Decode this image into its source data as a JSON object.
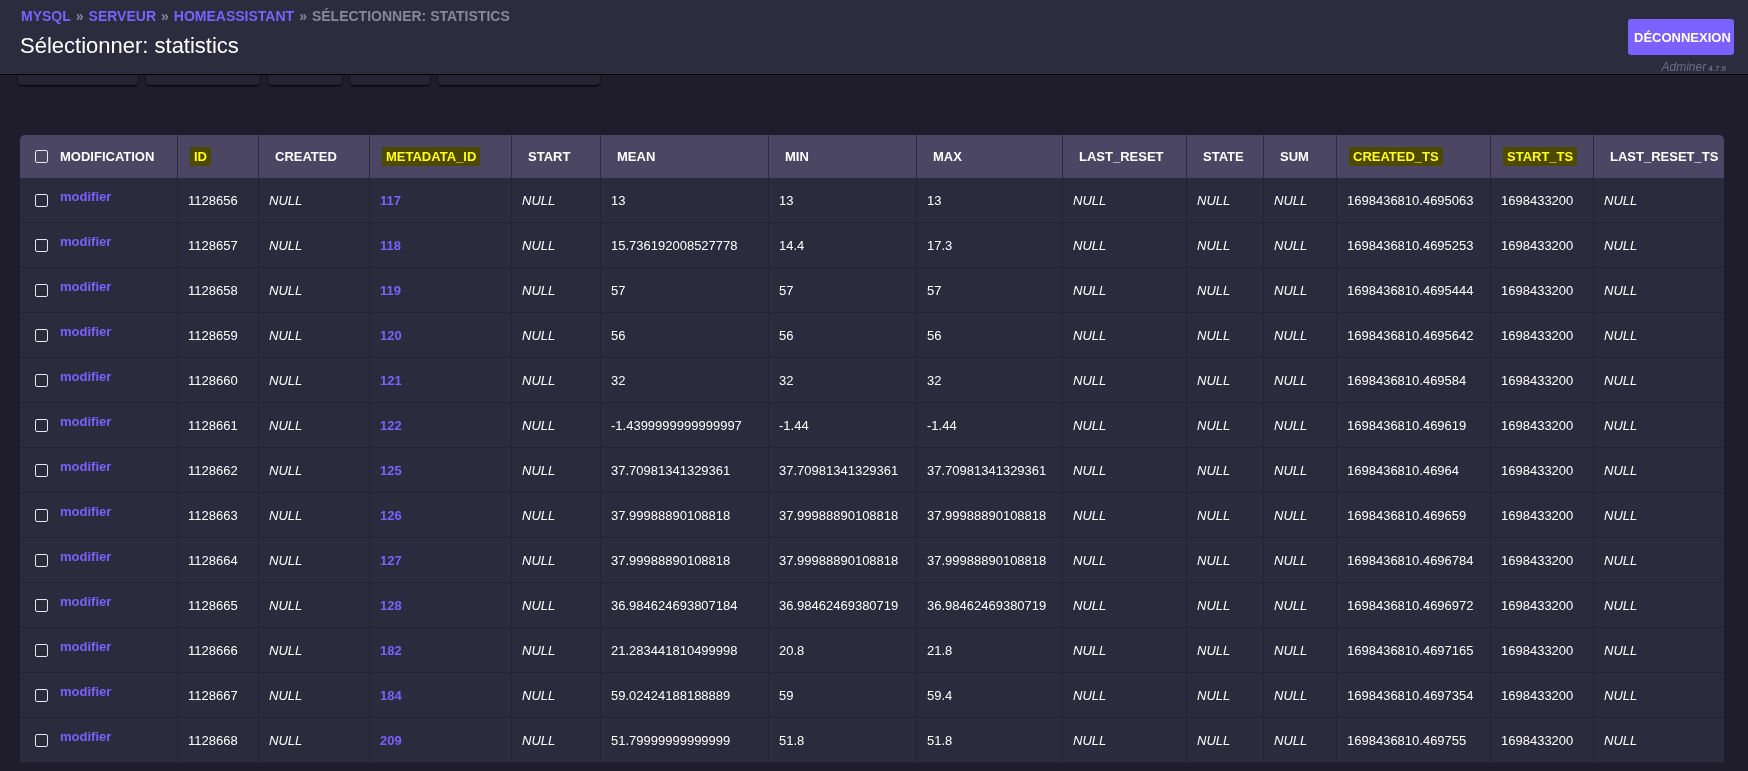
{
  "breadcrumb": [
    {
      "label": "MYSQL",
      "kind": "link"
    },
    {
      "label": "»",
      "kind": "separator"
    },
    {
      "label": "SERVEUR",
      "kind": "link"
    },
    {
      "label": "»",
      "kind": "separator"
    },
    {
      "label": "HOMEASSISTANT",
      "kind": "link"
    },
    {
      "label": "»",
      "kind": "separator"
    },
    {
      "label": "SÉLECTIONNER: STATISTICS",
      "kind": "current"
    }
  ],
  "title": "Sélectionner: statistics",
  "logout_button": "DÉCONNEXION",
  "app_name": "Adminer",
  "app_version": "4.7.9",
  "table": {
    "select_all": {
      "checked": false
    },
    "action_column": "MODIFICATION",
    "columns": [
      {
        "label": "ID",
        "kind": "plain",
        "highlighted": true
      },
      {
        "label": "CREATED",
        "kind": "null",
        "highlighted": false
      },
      {
        "label": "METADATA_ID",
        "kind": "link",
        "highlighted": true
      },
      {
        "label": "START",
        "kind": "null",
        "highlighted": false
      },
      {
        "label": "MEAN",
        "kind": "plain",
        "highlighted": false
      },
      {
        "label": "MIN",
        "kind": "plain",
        "highlighted": false
      },
      {
        "label": "MAX",
        "kind": "plain",
        "highlighted": false
      },
      {
        "label": "LAST_RESET",
        "kind": "null",
        "highlighted": false
      },
      {
        "label": "STATE",
        "kind": "null",
        "highlighted": false
      },
      {
        "label": "SUM",
        "kind": "null",
        "highlighted": false
      },
      {
        "label": "CREATED_TS",
        "kind": "plain",
        "highlighted": true
      },
      {
        "label": "START_TS",
        "kind": "plain",
        "highlighted": true
      },
      {
        "label": "LAST_RESET_TS",
        "kind": "null",
        "highlighted": false
      }
    ],
    "rows": [
      {
        "checked": false,
        "action": "modifier",
        "cells": [
          "1128656",
          "NULL",
          "117",
          "NULL",
          "13",
          "13",
          "13",
          "NULL",
          "NULL",
          "NULL",
          "1698436810.4695063",
          "1698433200",
          "NULL"
        ]
      },
      {
        "checked": false,
        "action": "modifier",
        "cells": [
          "1128657",
          "NULL",
          "118",
          "NULL",
          "15.736192008527778",
          "14.4",
          "17.3",
          "NULL",
          "NULL",
          "NULL",
          "1698436810.4695253",
          "1698433200",
          "NULL"
        ]
      },
      {
        "checked": false,
        "action": "modifier",
        "cells": [
          "1128658",
          "NULL",
          "119",
          "NULL",
          "57",
          "57",
          "57",
          "NULL",
          "NULL",
          "NULL",
          "1698436810.4695444",
          "1698433200",
          "NULL"
        ]
      },
      {
        "checked": false,
        "action": "modifier",
        "cells": [
          "1128659",
          "NULL",
          "120",
          "NULL",
          "56",
          "56",
          "56",
          "NULL",
          "NULL",
          "NULL",
          "1698436810.4695642",
          "1698433200",
          "NULL"
        ]
      },
      {
        "checked": false,
        "action": "modifier",
        "cells": [
          "1128660",
          "NULL",
          "121",
          "NULL",
          "32",
          "32",
          "32",
          "NULL",
          "NULL",
          "NULL",
          "1698436810.469584",
          "1698433200",
          "NULL"
        ]
      },
      {
        "checked": false,
        "action": "modifier",
        "cells": [
          "1128661",
          "NULL",
          "122",
          "NULL",
          "-1.4399999999999997",
          "-1.44",
          "-1.44",
          "NULL",
          "NULL",
          "NULL",
          "1698436810.469619",
          "1698433200",
          "NULL"
        ]
      },
      {
        "checked": false,
        "action": "modifier",
        "cells": [
          "1128662",
          "NULL",
          "125",
          "NULL",
          "37.70981341329361",
          "37.70981341329361",
          "37.70981341329361",
          "NULL",
          "NULL",
          "NULL",
          "1698436810.46964",
          "1698433200",
          "NULL"
        ]
      },
      {
        "checked": false,
        "action": "modifier",
        "cells": [
          "1128663",
          "NULL",
          "126",
          "NULL",
          "37.99988890108818",
          "37.99988890108818",
          "37.99988890108818",
          "NULL",
          "NULL",
          "NULL",
          "1698436810.469659",
          "1698433200",
          "NULL"
        ]
      },
      {
        "checked": false,
        "action": "modifier",
        "cells": [
          "1128664",
          "NULL",
          "127",
          "NULL",
          "37.99988890108818",
          "37.99988890108818",
          "37.99988890108818",
          "NULL",
          "NULL",
          "NULL",
          "1698436810.4696784",
          "1698433200",
          "NULL"
        ]
      },
      {
        "checked": false,
        "action": "modifier",
        "cells": [
          "1128665",
          "NULL",
          "128",
          "NULL",
          "36.984624693807184",
          "36.98462469380719",
          "36.98462469380719",
          "NULL",
          "NULL",
          "NULL",
          "1698436810.4696972",
          "1698433200",
          "NULL"
        ]
      },
      {
        "checked": false,
        "action": "modifier",
        "cells": [
          "1128666",
          "NULL",
          "182",
          "NULL",
          "21.283441810499998",
          "20.8",
          "21.8",
          "NULL",
          "NULL",
          "NULL",
          "1698436810.4697165",
          "1698433200",
          "NULL"
        ]
      },
      {
        "checked": false,
        "action": "modifier",
        "cells": [
          "1128667",
          "NULL",
          "184",
          "NULL",
          "59.02424188188889",
          "59",
          "59.4",
          "NULL",
          "NULL",
          "NULL",
          "1698436810.4697354",
          "1698433200",
          "NULL"
        ]
      },
      {
        "checked": false,
        "action": "modifier",
        "cells": [
          "1128668",
          "NULL",
          "209",
          "NULL",
          "51.79999999999999",
          "51.8",
          "51.8",
          "NULL",
          "NULL",
          "NULL",
          "1698436810.469755",
          "1698433200",
          "NULL"
        ]
      }
    ]
  }
}
